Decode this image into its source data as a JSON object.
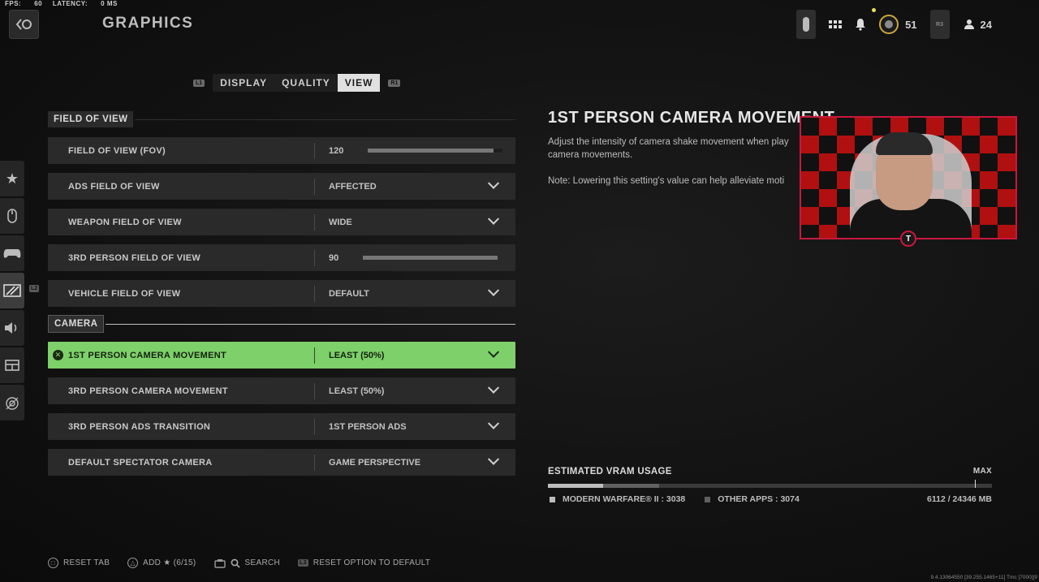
{
  "stats": {
    "fps_label": "FPS:",
    "fps": "60",
    "latency_label": "LATENCY:",
    "latency": "0 MS"
  },
  "header": {
    "title": "GRAPHICS"
  },
  "topbar": {
    "level": "51",
    "friends": "24",
    "r3": "R3"
  },
  "tabs": {
    "left_bumper": "L1",
    "right_bumper": "R1",
    "items": [
      "DISPLAY",
      "QUALITY",
      "VIEW"
    ],
    "active": "VIEW"
  },
  "siderail": {
    "bumper": "L2"
  },
  "sections": {
    "fov": "FIELD OF VIEW",
    "camera": "CAMERA"
  },
  "rows": [
    {
      "label": "FIELD OF VIEW (FOV)",
      "value": "120",
      "slider": 0.93
    },
    {
      "label": "ADS FIELD OF VIEW",
      "value": "AFFECTED"
    },
    {
      "label": "WEAPON FIELD OF VIEW",
      "value": "WIDE"
    },
    {
      "label": "3RD PERSON FIELD OF VIEW",
      "value": "90",
      "slider": 1.0
    },
    {
      "label": "VEHICLE FIELD OF VIEW",
      "value": "DEFAULT"
    },
    {
      "label": "1ST PERSON CAMERA MOVEMENT",
      "value": "LEAST (50%)"
    },
    {
      "label": "3RD PERSON CAMERA MOVEMENT",
      "value": "LEAST (50%)"
    },
    {
      "label": "3RD PERSON ADS TRANSITION",
      "value": "1ST PERSON ADS"
    },
    {
      "label": "DEFAULT SPECTATOR CAMERA",
      "value": "GAME PERSPECTIVE"
    }
  ],
  "description": {
    "title": "1ST PERSON CAMERA MOVEMENT",
    "text": "Adjust the intensity of camera shake movement when play camera movements.",
    "note": "Note: Lowering this setting's value can help alleviate moti"
  },
  "vram": {
    "title": "ESTIMATED VRAM USAGE",
    "max_label": "MAX",
    "mw_label": "MODERN WARFARE® II : 3038",
    "other_label": "OTHER APPS : 3074",
    "total": "6112 / 24346 MB",
    "mw_value": 3038,
    "other_value": 3074,
    "capacity": 24346,
    "colors": {
      "mw": "#bdbdbd",
      "other": "#606060"
    }
  },
  "footer": {
    "reset_tab": "RESET TAB",
    "add": "ADD ★ (6/15)",
    "search": "SEARCH",
    "reset_option": "RESET OPTION TO DEFAULT",
    "l3": "L3"
  },
  "version": "9.4.13064550 [39.255.1465+11] Tmc [7000][9"
}
